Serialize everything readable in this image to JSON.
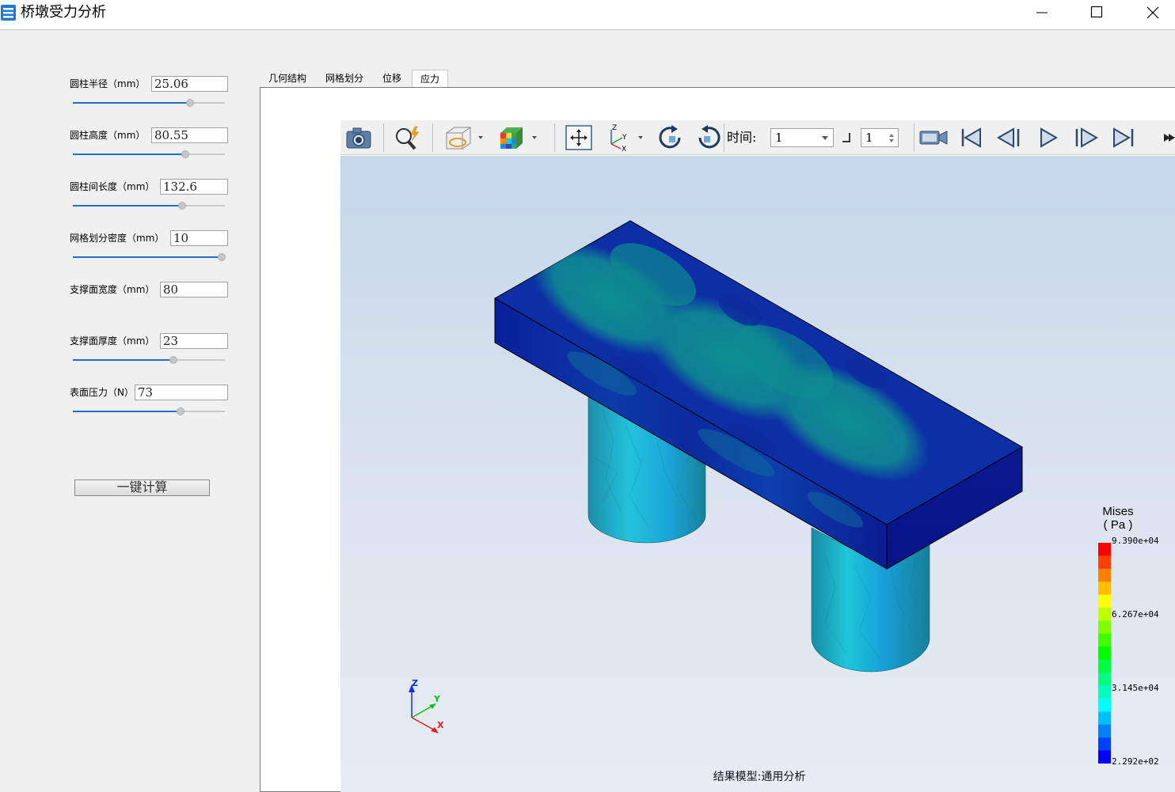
{
  "window": {
    "title": "桥墩受力分析",
    "controls": [
      "minimize",
      "maximize",
      "close"
    ]
  },
  "params": [
    {
      "label": "圆柱半径（mm）",
      "value": "25.06",
      "slider_pct": 77
    },
    {
      "label": "圆柱高度（mm）",
      "value": "80.55",
      "slider_pct": 74
    },
    {
      "label": "圆柱间长度（mm）",
      "value": "132.6",
      "slider_pct": 72
    },
    {
      "label": "网格划分密度（mm）",
      "value": "10",
      "slider_pct": 98
    },
    {
      "label": "支撑面宽度（mm）",
      "value": "80",
      "slider_pct": null
    },
    {
      "label": "支撑面厚度（mm）",
      "value": "23",
      "slider_pct": 66
    },
    {
      "label": "表面压力（N）",
      "value": "73",
      "slider_pct": 71
    }
  ],
  "calc_button": "一键计算",
  "tabs": [
    {
      "label": "几何结构",
      "active": false
    },
    {
      "label": "网格划分",
      "active": false
    },
    {
      "label": "位移",
      "active": false
    },
    {
      "label": "应力",
      "active": true
    }
  ],
  "toolbar": {
    "icons": [
      "camera-icon",
      "zoom-icon",
      "display-mode-icon",
      "colormap-icon",
      "fit-view-icon",
      "axis-orientation-icon",
      "rotate-cw-icon",
      "rotate-ccw-icon",
      "video-icon",
      "first-frame-icon",
      "prev-frame-icon",
      "play-icon",
      "next-frame-icon",
      "last-frame-icon",
      "more-icon"
    ],
    "time_label": "时间:",
    "time_value": "1",
    "step_value": "1"
  },
  "viewport": {
    "status": "结果模型:通用分析",
    "triad": {
      "z": "Z",
      "y": "Y",
      "x": "X"
    }
  },
  "legend": {
    "title": "Mises",
    "unit": "( Pa )",
    "ticks": [
      "9.390e+04",
      "6.267e+04",
      "3.145e+04",
      "2.292e+02"
    ],
    "colors": [
      "#ff0000",
      "#ff4000",
      "#ff8000",
      "#ffbf00",
      "#ffff00",
      "#bfff00",
      "#80ff00",
      "#40ff00",
      "#00ff00",
      "#00ff40",
      "#00ff80",
      "#00ffbf",
      "#00ffff",
      "#00bfff",
      "#0080ff",
      "#0040ff",
      "#0000ff"
    ]
  }
}
